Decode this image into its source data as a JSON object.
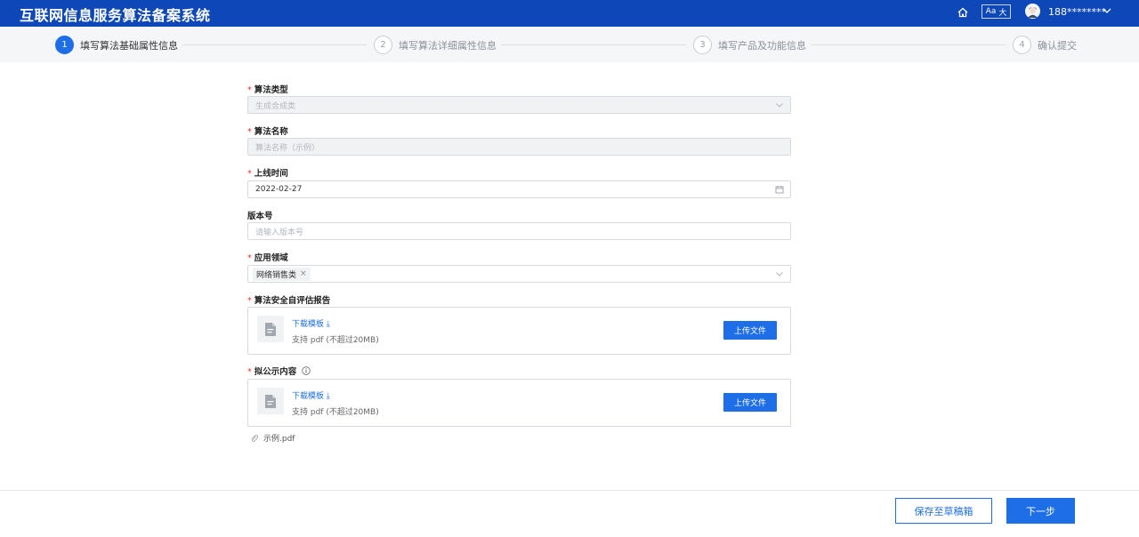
{
  "header": {
    "title": "互联网信息服务算法备案系统",
    "font_btn_small": "Aa",
    "font_btn_large": "大",
    "user": "188********"
  },
  "steps": [
    {
      "num": "1",
      "label": "填写算法基础属性信息",
      "active": true
    },
    {
      "num": "2",
      "label": "填写算法详细属性信息",
      "active": false
    },
    {
      "num": "3",
      "label": "填写产品及功能信息",
      "active": false
    },
    {
      "num": "4",
      "label": "确认提交",
      "active": false
    }
  ],
  "form": {
    "algo_type": {
      "label": "算法类型",
      "required": true,
      "value": "生成合成类"
    },
    "algo_name": {
      "label": "算法名称",
      "required": true,
      "placeholder": "算法名称（示例）"
    },
    "online_time": {
      "label": "上线时间",
      "required": true,
      "value": "2022-02-27"
    },
    "version": {
      "label": "版本号",
      "required": false,
      "placeholder": "请输入版本号"
    },
    "domain": {
      "label": "应用领域",
      "required": true,
      "tag": "网络销售类"
    },
    "self_report": {
      "label": "算法安全自评估报告",
      "required": true,
      "download": "下载模板",
      "hint": "支持 pdf (不超过20MB)",
      "upload": "上传文件"
    },
    "public_content": {
      "label": "拟公示内容",
      "required": true,
      "download": "下载模板",
      "hint": "支持 pdf (不超过20MB)",
      "upload": "上传文件"
    },
    "attachment": "示例.pdf"
  },
  "footer": {
    "draft": "保存至草稿箱",
    "next": "下一步"
  },
  "colors": {
    "header_bg": "#0d47b8",
    "primary": "#1e6ee8",
    "required": "#e0362c"
  }
}
